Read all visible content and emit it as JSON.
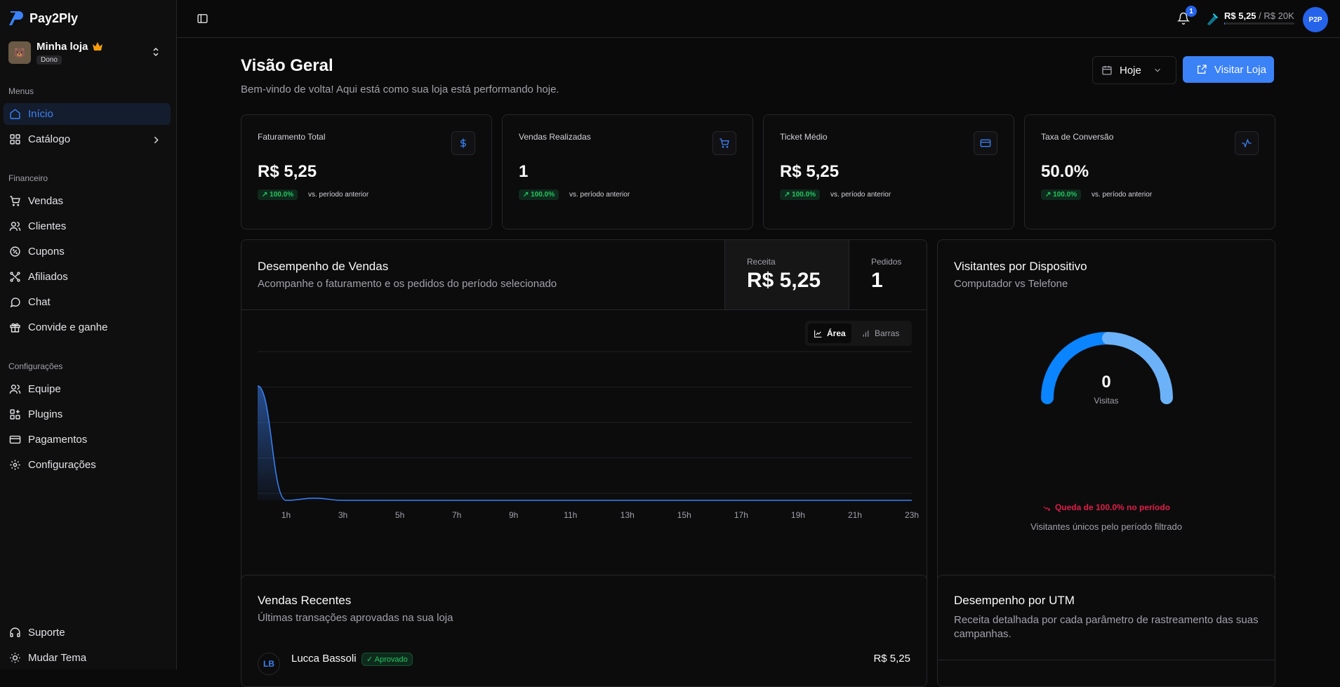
{
  "app": {
    "name": "Pay2Ply"
  },
  "store": {
    "name": "Minha loja",
    "badge": "Dono"
  },
  "sidebar": {
    "menus_label": "Menus",
    "financeiro_label": "Financeiro",
    "config_label": "Configurações",
    "items": [
      {
        "label": "Início",
        "icon": "home-icon"
      },
      {
        "label": "Catálogo",
        "icon": "grid-icon"
      },
      {
        "label": "Vendas",
        "icon": "cart-icon"
      },
      {
        "label": "Clientes",
        "icon": "users-icon"
      },
      {
        "label": "Cupons",
        "icon": "coupon-icon"
      },
      {
        "label": "Afiliados",
        "icon": "network-icon"
      },
      {
        "label": "Chat",
        "icon": "chat-icon"
      },
      {
        "label": "Convide e ganhe",
        "icon": "gift-icon"
      },
      {
        "label": "Equipe",
        "icon": "team-icon"
      },
      {
        "label": "Plugins",
        "icon": "plugins-icon"
      },
      {
        "label": "Pagamentos",
        "icon": "card-icon"
      },
      {
        "label": "Configurações",
        "icon": "gear-icon"
      }
    ],
    "footer": [
      {
        "label": "Suporte",
        "icon": "headset-icon"
      },
      {
        "label": "Mudar Tema",
        "icon": "sun-icon"
      }
    ]
  },
  "topbar": {
    "notifications": "1",
    "goal_current": "R$ 5,25",
    "goal_target": " / R$ 20K",
    "goal_progress": 0.0003,
    "avatar_text": "P2P"
  },
  "header": {
    "title": "Visão Geral",
    "subtitle": "Bem-vindo de volta! Aqui está como sua loja está performando hoje.",
    "date_filter": "Hoje",
    "visit_button": "Visitar Loja"
  },
  "stats": [
    {
      "label": "Faturamento Total",
      "value": "R$ 5,25",
      "change": "100.0%",
      "vs": "vs. período anterior",
      "icon": "dollar-icon"
    },
    {
      "label": "Vendas Realizadas",
      "value": "1",
      "change": "100.0%",
      "vs": "vs. período anterior",
      "icon": "cart-icon"
    },
    {
      "label": "Ticket Médio",
      "value": "R$ 5,25",
      "change": "100.0%",
      "vs": "vs. período anterior",
      "icon": "card-icon"
    },
    {
      "label": "Taxa de Conversão",
      "value": "50.0%",
      "change": "100.0%",
      "vs": "vs. período anterior",
      "icon": "activity-icon"
    }
  ],
  "sales_chart": {
    "title": "Desempenho de Vendas",
    "subtitle": "Acompanhe o faturamento e os pedidos do período selecionado",
    "revenue_label": "Receita",
    "revenue_value": "R$ 5,25",
    "orders_label": "Pedidos",
    "orders_value": "1",
    "toggle_area": "Área",
    "toggle_bars": "Barras",
    "accent": "#3b82f6"
  },
  "chart_data": {
    "type": "area",
    "x": [
      "0h",
      "1h",
      "2h",
      "3h",
      "4h",
      "5h",
      "6h",
      "7h",
      "8h",
      "9h",
      "10h",
      "11h",
      "12h",
      "13h",
      "14h",
      "15h",
      "16h",
      "17h",
      "18h",
      "19h",
      "20h",
      "21h",
      "22h",
      "23h"
    ],
    "tick_labels": [
      "1h",
      "3h",
      "5h",
      "7h",
      "9h",
      "11h",
      "13h",
      "15h",
      "17h",
      "19h",
      "21h",
      "23h"
    ],
    "values": [
      5.25,
      0,
      0.1,
      0,
      0,
      0,
      0,
      0,
      0,
      0,
      0,
      0,
      0,
      0,
      0,
      0,
      0,
      0,
      0,
      0,
      0,
      0,
      0,
      0
    ],
    "ylim": [
      0,
      6.5
    ],
    "grid": true,
    "xlabel": "",
    "ylabel": ""
  },
  "devices": {
    "title": "Visitantes por Dispositivo",
    "subtitle": "Computador vs Telefone",
    "total": "0",
    "total_label": "Visitas",
    "drop_text": "Queda de 100.0% no período",
    "footnote": "Visitantes únicos pelo período filtrado",
    "colors": {
      "computer": "#0a84ff",
      "phone": "#6cb2f8"
    }
  },
  "recent_sales": {
    "title": "Vendas Recentes",
    "subtitle": "Últimas transações aprovadas na sua loja",
    "rows": [
      {
        "initials": "LB",
        "name": "Lucca Bassoli",
        "status": "Aprovado",
        "amount": "R$ 5,25"
      }
    ]
  },
  "utm": {
    "title": "Desempenho por UTM",
    "subtitle": "Receita detalhada por cada parâmetro de rastreamento das suas campanhas."
  }
}
